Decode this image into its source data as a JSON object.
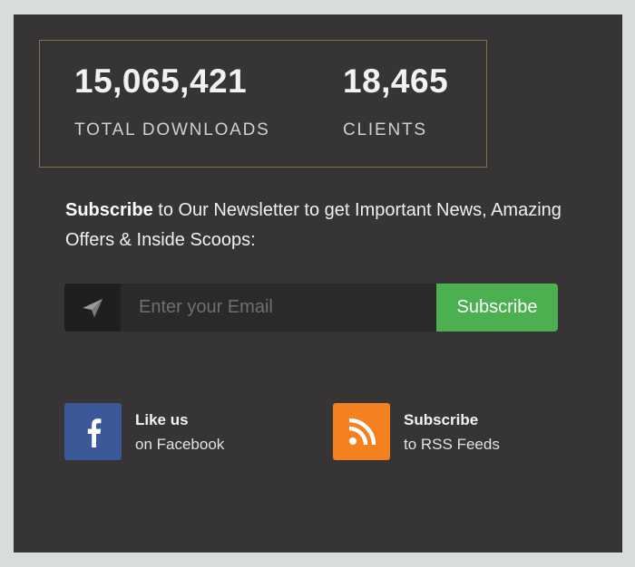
{
  "stats": {
    "downloads": {
      "value": "15,065,421",
      "label": "TOTAL DOWNLOADS"
    },
    "clients": {
      "value": "18,465",
      "label": "CLIENTS"
    }
  },
  "newsletter": {
    "lead": "Subscribe",
    "text": " to Our Newsletter to get Important News, Amazing Offers & Inside Scoops:"
  },
  "form": {
    "placeholder": "Enter your Email",
    "email_value": "",
    "button_label": "Subscribe",
    "icon": "paper-plane-icon"
  },
  "social": {
    "facebook": {
      "title": "Like us",
      "subtitle": "on Facebook",
      "icon": "facebook-icon",
      "color": "#3b5998"
    },
    "rss": {
      "title": "Subscribe",
      "subtitle": "to RSS Feeds",
      "icon": "rss-icon",
      "color": "#f48120"
    }
  },
  "colors": {
    "panel": "#363435",
    "accent_green": "#4cb050",
    "facebook": "#3b5998",
    "rss": "#f48120",
    "stats_border": "#78784f"
  }
}
